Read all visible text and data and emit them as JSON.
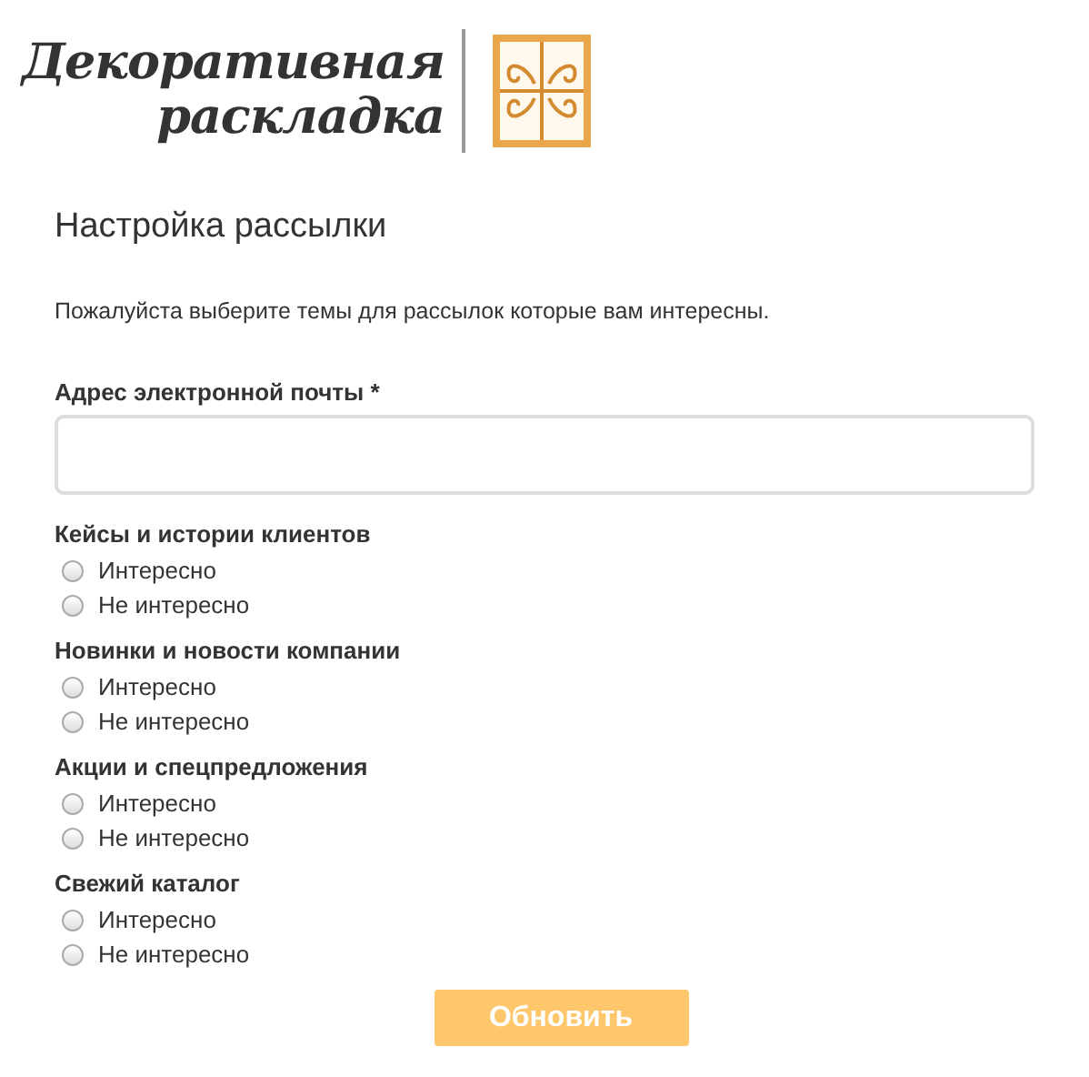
{
  "logo": {
    "line_1": "Декоративная",
    "line_2": "раскладка"
  },
  "title": "Настройка рассылки",
  "description": "Пожалуйста выберите темы для рассылок которые вам интересны.",
  "email": {
    "label": "Адрес электронной почты *"
  },
  "topics": [
    {
      "heading": "Кейсы и истории клиентов",
      "options": [
        {
          "label": "Интересно",
          "selected": false
        },
        {
          "label": "Не интересно",
          "selected": false
        }
      ]
    },
    {
      "heading": "Новинки и новости компании",
      "options": [
        {
          "label": "Интересно",
          "selected": false
        },
        {
          "label": "Не интересно",
          "selected": false
        }
      ]
    },
    {
      "heading": "Акции и спецпредложения",
      "options": [
        {
          "label": "Интересно",
          "selected": false
        },
        {
          "label": "Не интересно",
          "selected": false
        }
      ]
    },
    {
      "heading": "Свежий каталог",
      "options": [
        {
          "label": "Интересно",
          "selected": false
        },
        {
          "label": "Не интересно",
          "selected": false
        }
      ]
    }
  ],
  "submit_button": "Обновить"
}
